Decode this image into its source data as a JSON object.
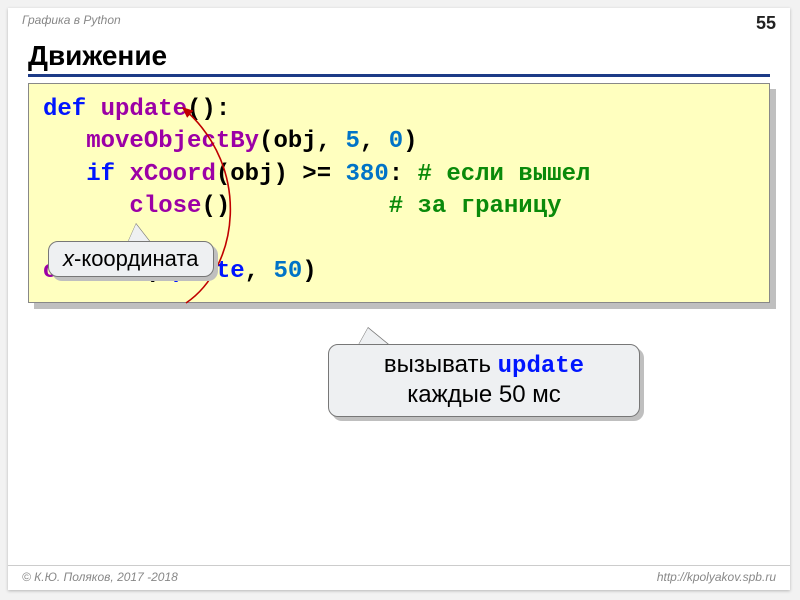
{
  "header": {
    "course": "Графика в Python",
    "page": "55"
  },
  "title": "Движение",
  "code": {
    "l1_def": "def ",
    "l1_fn": "update",
    "l1_rest": "():",
    "l2_indent": "   ",
    "l2_fn": "moveObjectBy",
    "l2_open": "(",
    "l2_arg1": "obj",
    "l2_c1": ", ",
    "l2_n1": "5",
    "l2_c2": ", ",
    "l2_n2": "0",
    "l2_close": ")",
    "l3_indent": "   ",
    "l3_if": "if ",
    "l3_fn": "xCoord",
    "l3_open": "(",
    "l3_arg": "obj",
    "l3_close": ") ",
    "l3_op": ">= ",
    "l3_num": "380",
    "l3_colon": ": ",
    "l3_cm": "# если вышел",
    "l4_indent": "      ",
    "l4_fn": "close",
    "l4_paren": "()",
    "l4_pad": "           ",
    "l4_cm": "# за границу",
    "blank": " ",
    "l6_fn": "onTimer",
    "l6_open": "(",
    "l6_arg": "update",
    "l6_c": ", ",
    "l6_num": "50",
    "l6_close": ")"
  },
  "callout1": {
    "x": "x",
    "rest": "-координата"
  },
  "callout2": {
    "line1a": "вызывать ",
    "line1b": "update",
    "line2": "каждые 50 мс"
  },
  "footer": {
    "left": "© К.Ю. Поляков, 2017 -2018",
    "right": "http://kpolyakov.spb.ru"
  }
}
